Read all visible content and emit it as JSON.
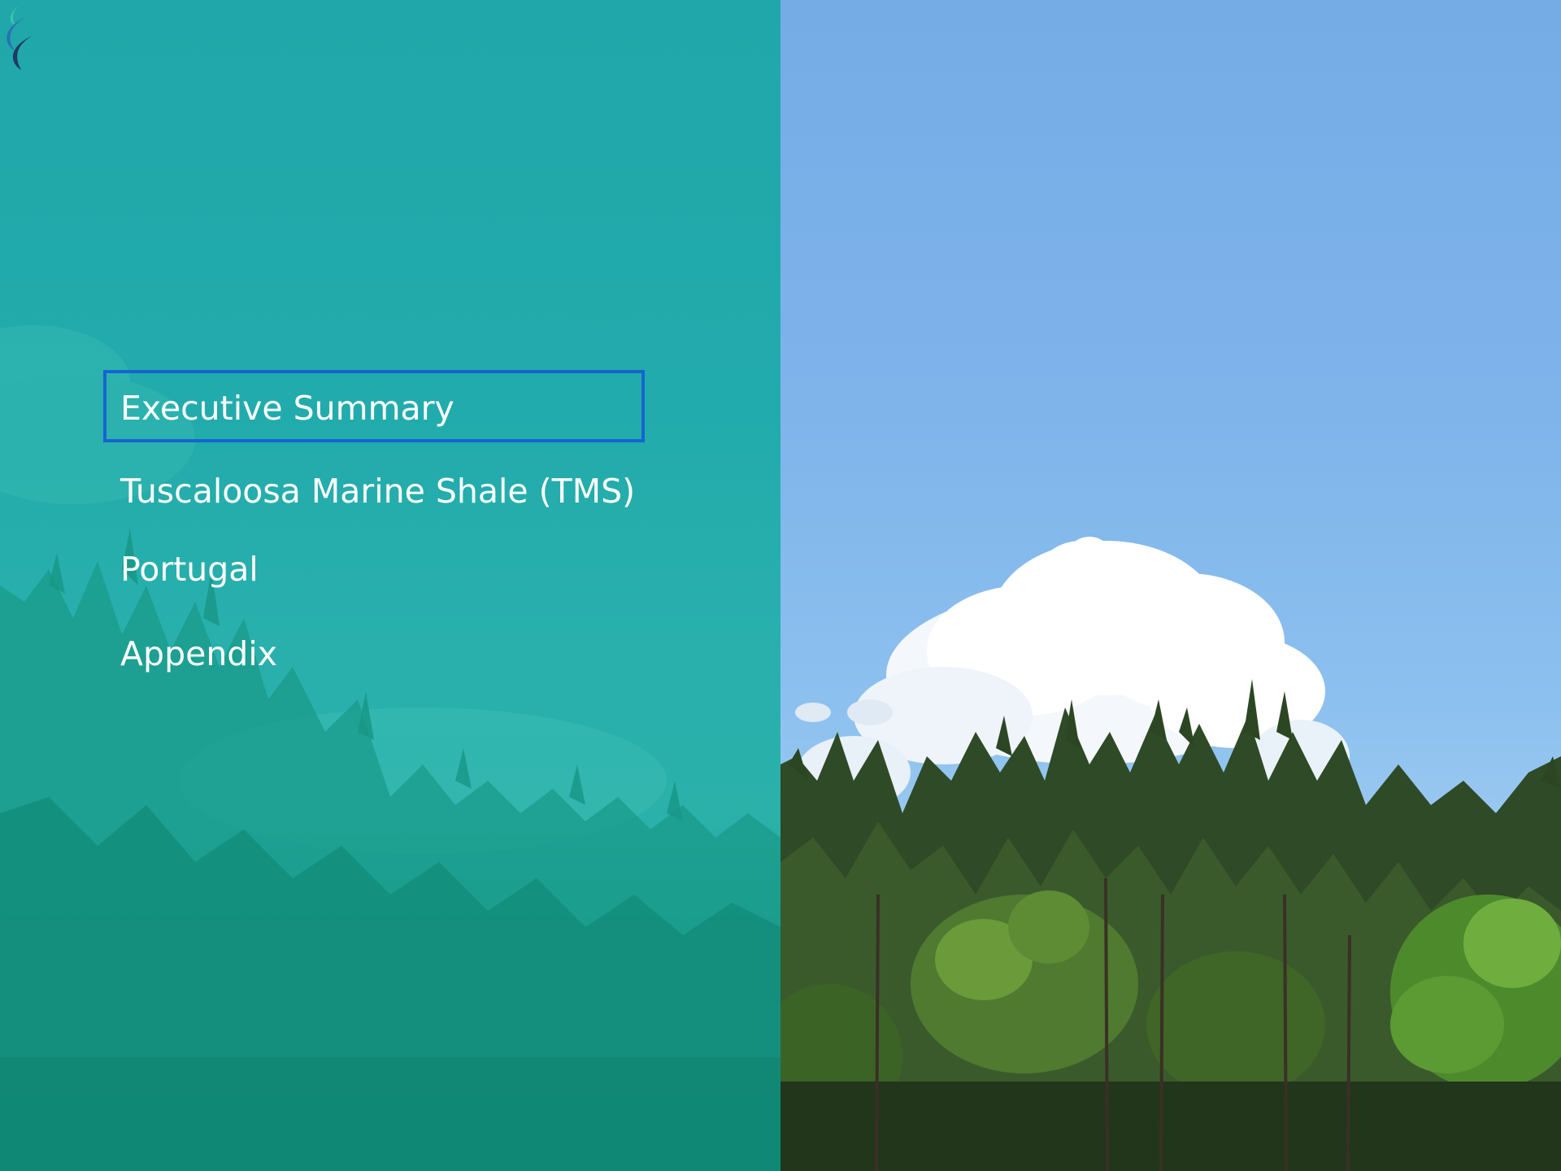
{
  "slide": {
    "agenda": {
      "items": [
        {
          "label": "Executive Summary",
          "active": true
        },
        {
          "label": "Tuscaloosa Marine Shale (TMS)",
          "active": false
        },
        {
          "label": "Portugal",
          "active": false
        },
        {
          "label": "Appendix",
          "active": false
        }
      ]
    },
    "colors": {
      "teal_overlay": "#20a7a9",
      "highlight_border": "#1565d0",
      "text": "#ffffff",
      "sky": "#7fb0e4",
      "logo_teal": "#3ec3b0",
      "logo_blue": "#2a6fb5",
      "logo_navy": "#1d3b66"
    },
    "icons": {
      "logo": "flame-logo-icon"
    }
  }
}
